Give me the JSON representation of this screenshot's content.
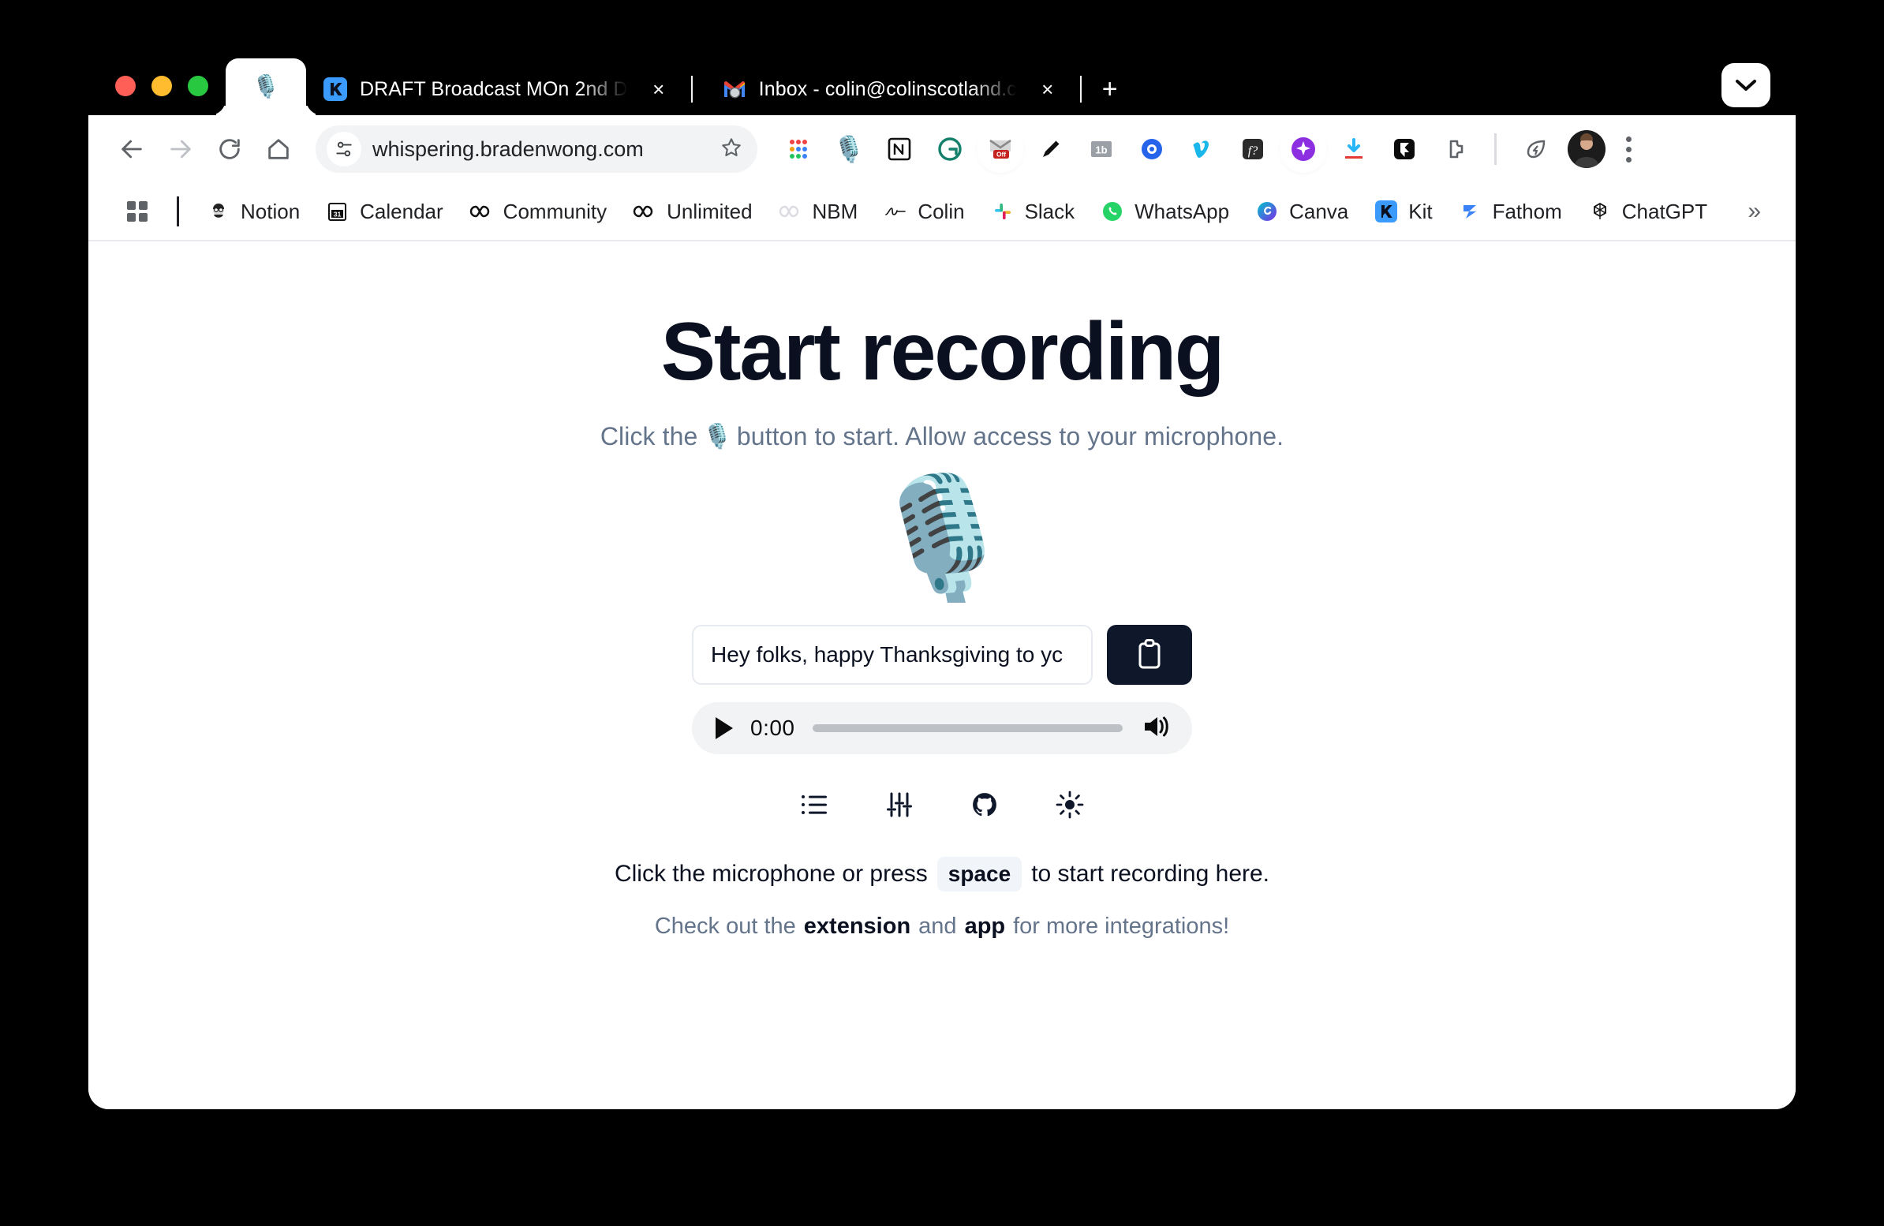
{
  "window": {
    "chevron_icon": "chevron-down-icon",
    "new_tab_label": "+"
  },
  "tabs": [
    {
      "favicon": "🎙️",
      "title": "",
      "active": true
    },
    {
      "favicon": "kit-logo",
      "title": "DRAFT Broadcast MOn 2nd D",
      "close": "×",
      "active": false
    },
    {
      "favicon": "gmail-logo",
      "title": "Inbox - colin@colinscotland.c",
      "close": "×",
      "active": false
    }
  ],
  "toolbar": {
    "back_icon": "back-arrow-icon",
    "forward_icon": "forward-arrow-icon",
    "reload_icon": "reload-icon",
    "home_icon": "home-icon",
    "site_info_icon": "site-settings-icon",
    "url": "whispering.bradenwong.com",
    "bookmark_icon": "star-icon",
    "extensions": [
      {
        "name": "bitly-dots-icon",
        "glyph": "⣿"
      },
      {
        "name": "whispering-mic-icon",
        "glyph": "🎙️"
      },
      {
        "name": "notion-icon",
        "glyph": "N"
      },
      {
        "name": "grammarly-icon",
        "glyph": "G"
      },
      {
        "name": "gmail-off-icon",
        "glyph": "M",
        "badge": "Off"
      },
      {
        "name": "pencil-icon",
        "glyph": "✏️"
      },
      {
        "name": "bitly-icon",
        "glyph": "1b"
      },
      {
        "name": "loom-icon",
        "glyph": "◉"
      },
      {
        "name": "vimeo-icon",
        "glyph": "V"
      },
      {
        "name": "fontanello-icon",
        "glyph": "f?"
      },
      {
        "name": "ai-sparkle-icon",
        "glyph": "✦"
      },
      {
        "name": "download-icon",
        "glyph": "⬇"
      },
      {
        "name": "framer-icon",
        "glyph": "F"
      },
      {
        "name": "puzzle-extensions-icon",
        "glyph": "🧩"
      }
    ],
    "leaf_icon": "leaf-shield-icon",
    "avatar": "user-avatar",
    "menu_icon": "three-dot-menu-icon"
  },
  "bookmarks": {
    "apps_icon": "bookmark-grid-icon",
    "items": [
      {
        "label": "Notion",
        "icon": "notion-person-icon"
      },
      {
        "label": "Calendar",
        "icon": "calendar-31-icon"
      },
      {
        "label": "Community",
        "icon": "infinity-icon"
      },
      {
        "label": "Unlimited",
        "icon": "infinity-icon"
      },
      {
        "label": "NBM",
        "icon": "infinity-faded-icon"
      },
      {
        "label": "Colin",
        "icon": "signature-icon"
      },
      {
        "label": "Slack",
        "icon": "slack-icon"
      },
      {
        "label": "WhatsApp",
        "icon": "whatsapp-icon"
      },
      {
        "label": "Canva",
        "icon": "canva-icon"
      },
      {
        "label": "Kit",
        "icon": "kit-icon"
      },
      {
        "label": "Fathom",
        "icon": "fathom-icon"
      },
      {
        "label": "ChatGPT",
        "icon": "chatgpt-icon"
      }
    ],
    "overflow_label": "»"
  },
  "main": {
    "title": "Start recording",
    "subtitle_before": "Click the",
    "subtitle_emoji": "🎙️",
    "subtitle_after": "button to start. Allow access to your microphone.",
    "mic_emoji": "🎙️",
    "transcript_value": "Hey folks, happy Thanksgiving to yc",
    "copy_icon": "clipboard-icon",
    "player": {
      "play_icon": "play-icon",
      "time": "0:00",
      "volume_icon": "volume-icon",
      "progress_percent": 0
    },
    "action_icons": [
      {
        "name": "recordings-list-icon"
      },
      {
        "name": "settings-sliders-icon"
      },
      {
        "name": "github-icon"
      },
      {
        "name": "light-mode-sun-icon"
      }
    ],
    "hint_before": "Click the microphone or press",
    "hint_key": "space",
    "hint_after": "to start recording here.",
    "footer_before": "Check out the",
    "footer_link1": "extension",
    "footer_mid": "and",
    "footer_link2": "app",
    "footer_after": "for more integrations!"
  },
  "colors": {
    "accent_dark": "#0f172a",
    "muted": "#64748b",
    "chrome_bg": "#ffffff",
    "titlebar": "#000000"
  }
}
